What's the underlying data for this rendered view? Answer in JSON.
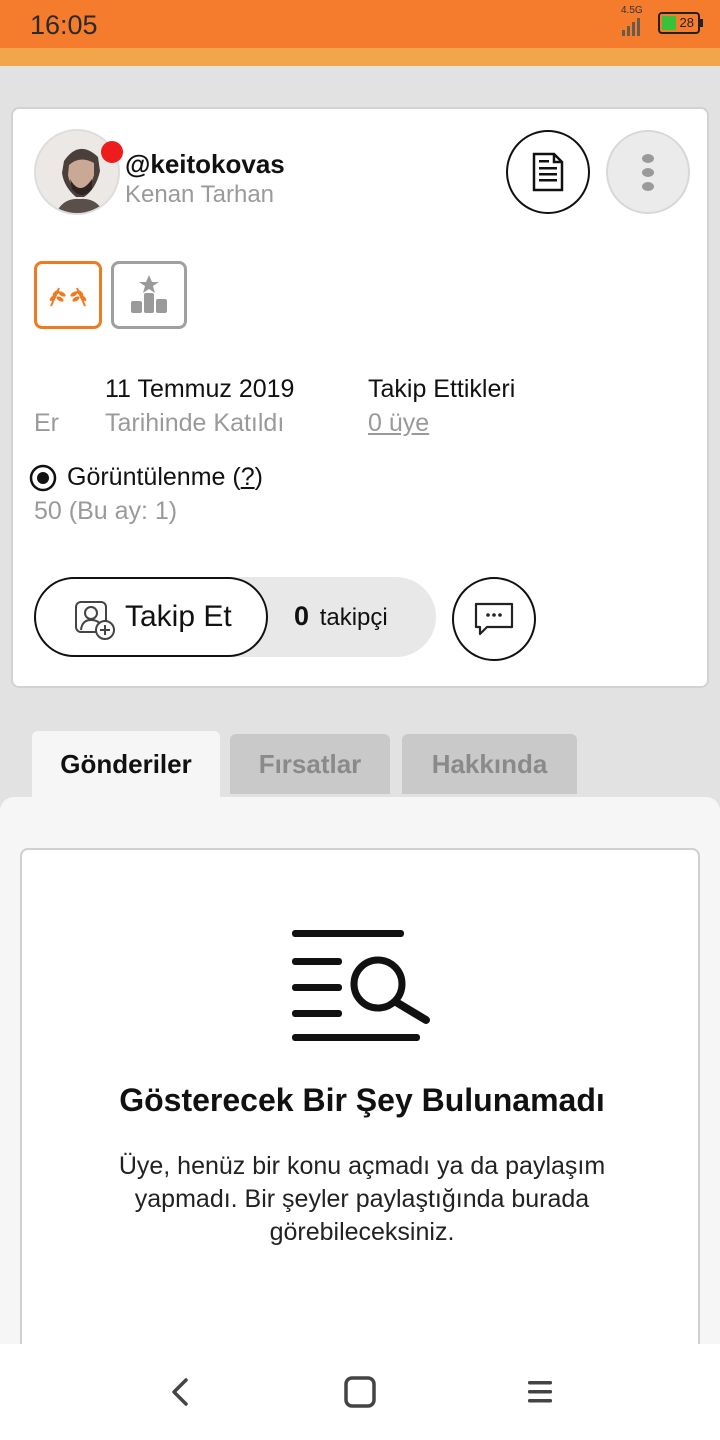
{
  "status_bar": {
    "time": "16:05",
    "network": "4.5G",
    "battery": "28",
    "bg_color": "#f47c2c"
  },
  "profile": {
    "username": "@keitokovas",
    "full_name": "Kenan Tarhan",
    "online_indicator_color": "#ee1c1c",
    "icons": {
      "document": "document-icon",
      "more": "more-vertical-icon",
      "laurel_badge": "laurel-badge-icon",
      "rank_badge": "leaderboard-badge-icon"
    }
  },
  "info": {
    "gender_label": "Er",
    "joined_date": "11 Temmuz 2019",
    "joined_sub": "Tarihinde Katıldı",
    "following_title": "Takip Ettikleri",
    "following_link": "0 üye",
    "views_title": "Görüntülenme",
    "views_help": "?",
    "views_count": "50 (Bu ay: 1)"
  },
  "actions": {
    "follow_label": "Takip Et",
    "follower_count": "0",
    "follower_label": "takipçi",
    "message_icon": "message-icon"
  },
  "tabs": [
    {
      "label": "Gönderiler",
      "active": true
    },
    {
      "label": "Fırsatlar",
      "active": false
    },
    {
      "label": "Hakkında",
      "active": false
    }
  ],
  "empty_state": {
    "title": "Gösterecek Bir Şey Bulunamadı",
    "description": "Üye, henüz bir konu açmadı ya da paylaşım yapmadı. Bir şeyler paylaştığında burada görebileceksiniz.",
    "icon": "search-list-icon"
  },
  "nav_bar": {
    "back": "back-icon",
    "home": "home-icon",
    "menu": "menu-icon"
  },
  "colors": {
    "accent": "#ef7a22",
    "accent_strip": "#f1a64b"
  }
}
